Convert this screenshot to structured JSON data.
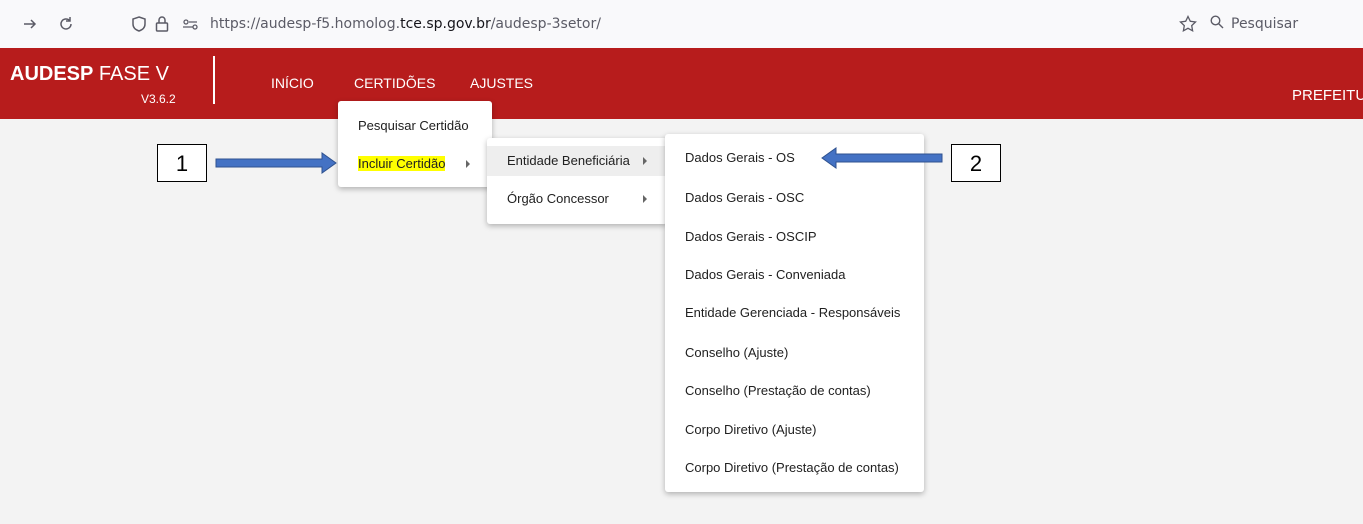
{
  "browser": {
    "url_prefix": "https://audesp-f5.homolog.",
    "url_domain": "tce.sp.gov.br",
    "url_suffix": "/audesp-3setor/",
    "search_placeholder": "Pesquisar",
    "icons": [
      "forward-icon",
      "reload-icon",
      "shield-icon",
      "lock-icon",
      "permissions-icon",
      "bookmark-star-icon",
      "search-icon"
    ]
  },
  "header": {
    "brand_bold": "AUDESP",
    "brand_rest": " FASE V",
    "version": "V3.6.2",
    "nav": [
      "INÍCIO",
      "CERTIDÕES",
      "AJUSTES"
    ],
    "user": "PREFEITU",
    "color": "#b71c1c"
  },
  "menu_certidoes": {
    "items": [
      "Pesquisar Certidão",
      "Incluir Certidão"
    ]
  },
  "menu_incluir": {
    "items": [
      "Entidade Beneficiária",
      "Órgão Concessor"
    ]
  },
  "menu_entidade": {
    "items": [
      "Dados Gerais - OS",
      "Dados Gerais - OSC",
      "Dados Gerais - OSCIP",
      "Dados Gerais - Conveniada",
      "Entidade Gerenciada - Responsáveis",
      "Conselho (Ajuste)",
      "Conselho (Prestação de contas)",
      "Corpo Diretivo (Ajuste)",
      "Corpo Diretivo (Prestação de contas)"
    ]
  },
  "annotations": {
    "label_1": "1",
    "label_2": "2",
    "arrow_color": "#4472c4"
  }
}
